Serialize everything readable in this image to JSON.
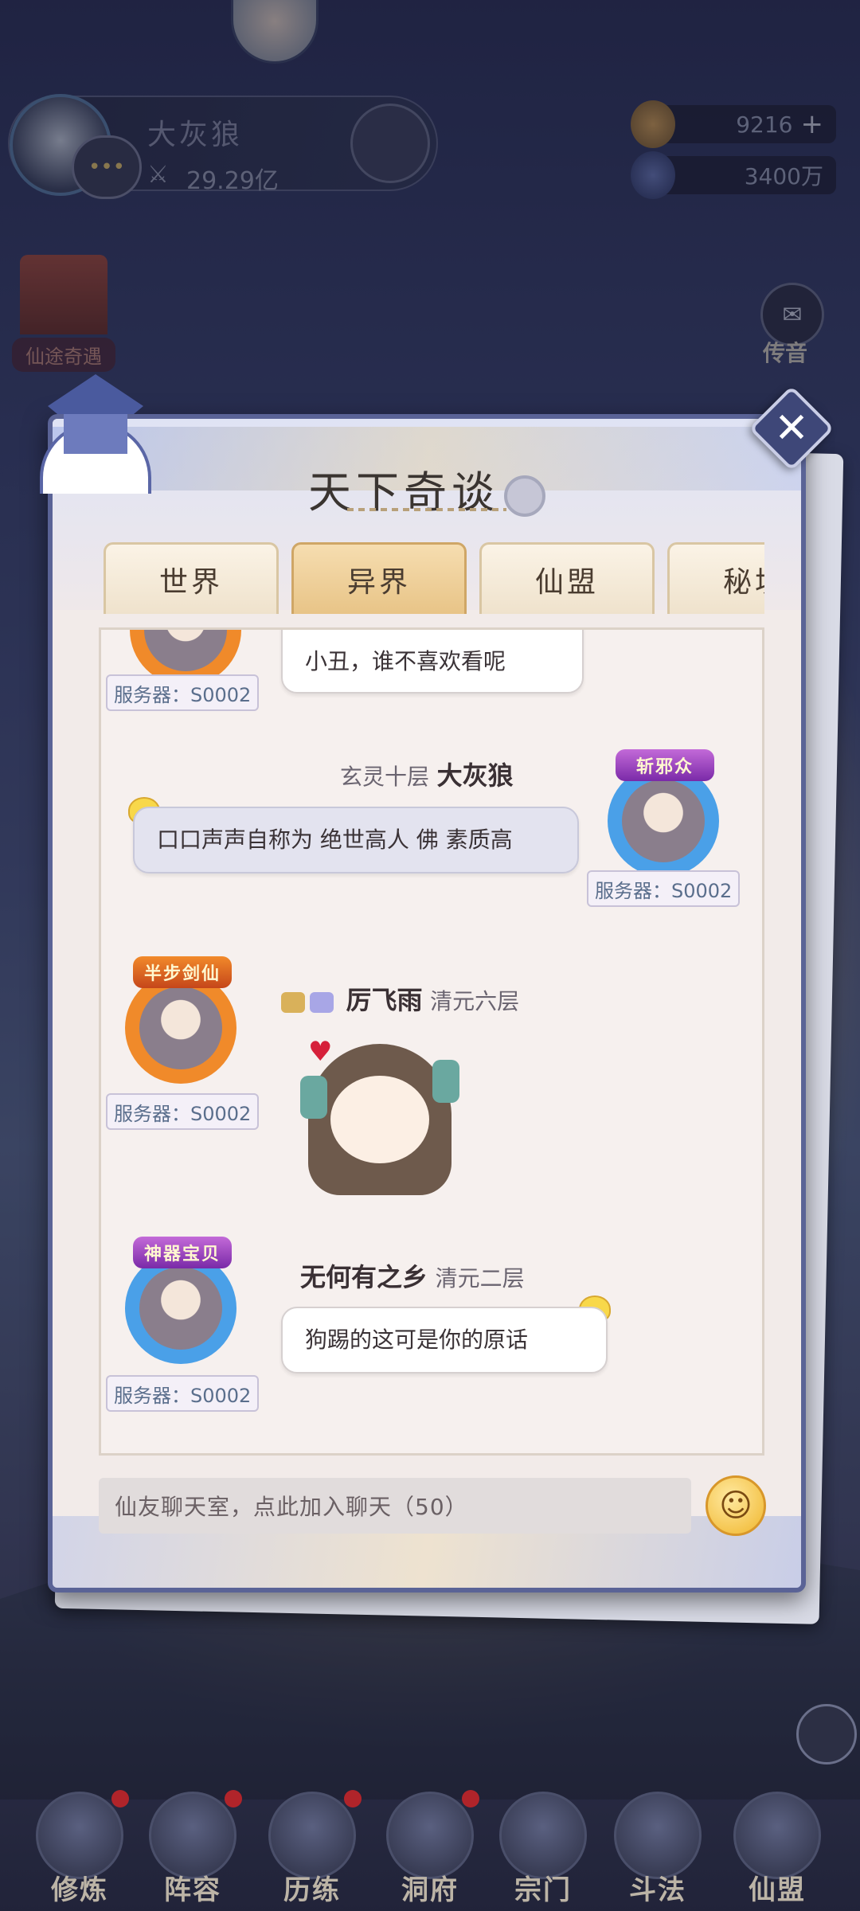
{
  "player": {
    "name": "大灰狼",
    "power": "29.29亿"
  },
  "currency": {
    "gold": "9216",
    "spirit": "3400万"
  },
  "side": {
    "event_label": "仙途奇遇",
    "mail_label": "传音"
  },
  "dialog": {
    "title": "天下奇谈",
    "close_symbol": "✕",
    "tabs": [
      {
        "label": "世界"
      },
      {
        "label": "异界"
      },
      {
        "label": "仙盟"
      },
      {
        "label": "秘境"
      }
    ]
  },
  "chat": {
    "messages": [
      {
        "server": "服务器：S0002",
        "text": "小丑，谁不喜欢看呢"
      },
      {
        "rank": "玄灵十层",
        "name": "大灰狼",
        "badge": "斩邪众",
        "server": "服务器：S0002",
        "text": "口口声声自称为 绝世高人 佛 素质高"
      },
      {
        "name": "厉飞雨",
        "rank": "清元六层",
        "badge": "半步剑仙",
        "server": "服务器：S0002"
      },
      {
        "name": "无何有之乡",
        "rank": "清元二层",
        "badge": "神器宝贝",
        "server": "服务器：S0002",
        "text": "狗踢的这可是你的原话"
      }
    ]
  },
  "input": {
    "placeholder": "仙友聊天室，点此加入聊天（50）"
  },
  "bottom_nav": [
    {
      "label": "修炼"
    },
    {
      "label": "阵容"
    },
    {
      "label": "历练"
    },
    {
      "label": "洞府"
    },
    {
      "label": "宗门"
    },
    {
      "label": "斗法"
    },
    {
      "label": "仙盟"
    }
  ],
  "colors": {
    "accent": "#5a6396",
    "tab_active": "#e8c487",
    "notify": "#b0242a"
  }
}
